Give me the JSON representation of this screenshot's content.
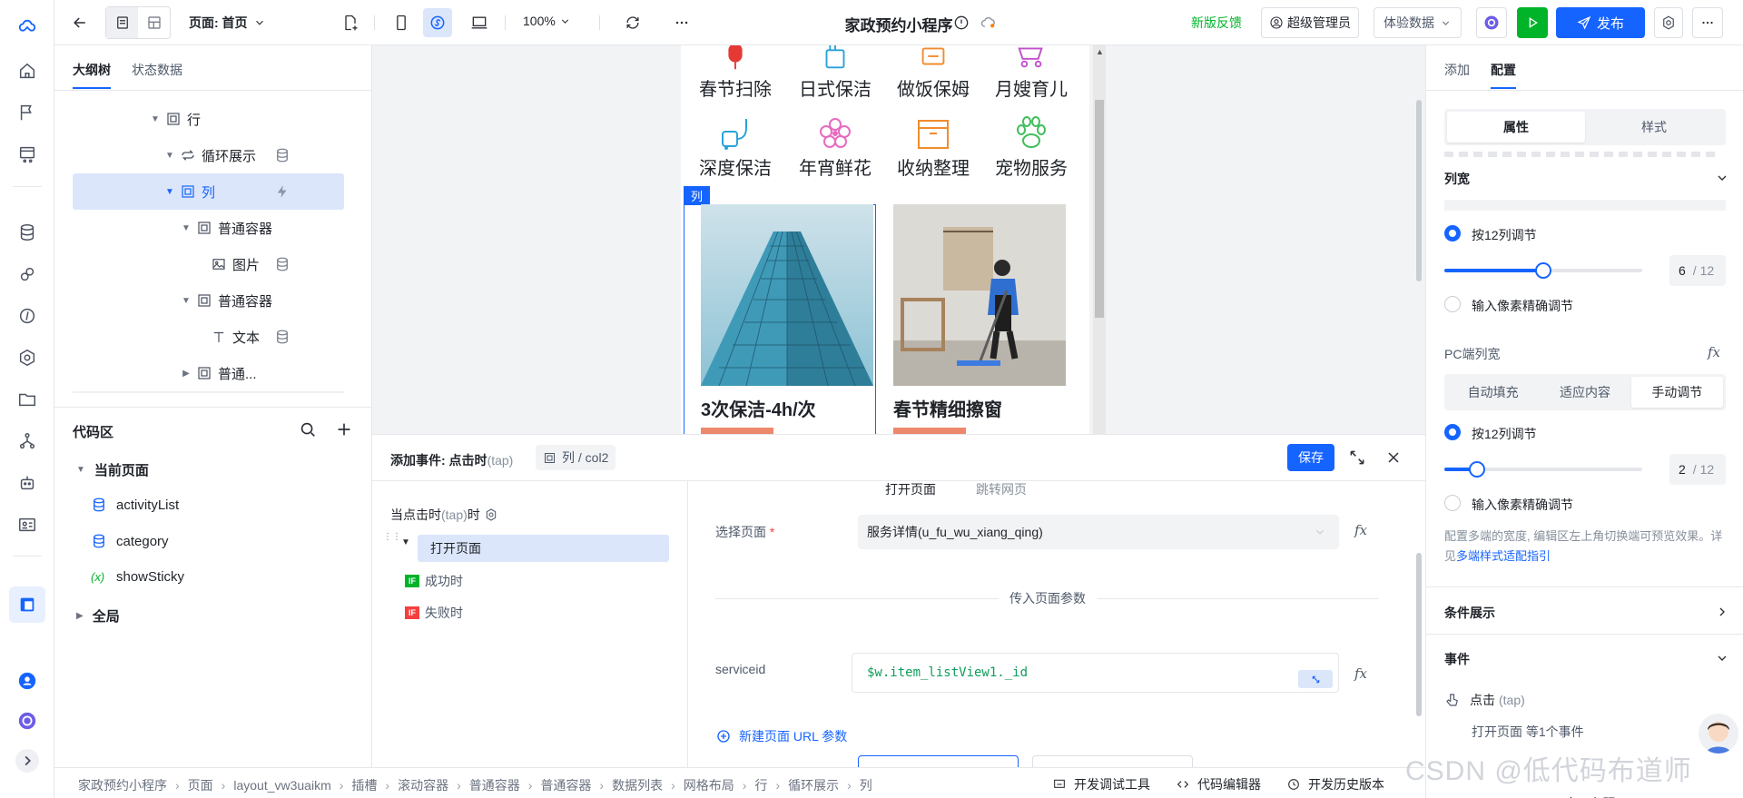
{
  "topbar": {
    "page_label": "页面: 首页",
    "zoom": "100%",
    "app_title": "家政预约小程序",
    "feedback": "新版反馈",
    "admin": "超级管理员",
    "data_mode": "体验数据",
    "publish": "发布"
  },
  "outline": {
    "tabs": [
      "大纲树",
      "状态数据"
    ],
    "items": [
      {
        "label": "行"
      },
      {
        "label": "循环展示"
      },
      {
        "label": "列"
      },
      {
        "label": "普通容器"
      },
      {
        "label": "图片"
      },
      {
        "label": "普通容器"
      },
      {
        "label": "文本"
      },
      {
        "label": "普通..."
      }
    ]
  },
  "code": {
    "title": "代码区",
    "current_page": "当前页面",
    "items": [
      "activityList",
      "category",
      "showSticky"
    ],
    "global": "全局"
  },
  "canvas": {
    "categories_row1": [
      "春节扫除",
      "日式保洁",
      "做饭保姆",
      "月嫂育儿"
    ],
    "categories_row2": [
      "深度保洁",
      "年宵鲜花",
      "收纳整理",
      "宠物服务"
    ],
    "col_badge": "列",
    "cards": [
      {
        "title": "3次保洁-4h/次"
      },
      {
        "title": "春节精细擦窗"
      }
    ],
    "colors": {
      "accent": "#1664ff",
      "selected": "#dbe6fb"
    }
  },
  "event_panel": {
    "title": "添加事件: 点击时",
    "title_tap": "(tap)",
    "target": "列 / col2",
    "save": "保存",
    "trigger": "当点击时",
    "trigger_tap": "(tap)",
    "trigger_suffix": "时",
    "action": "打开页面",
    "success": "成功时",
    "failure": "失败时",
    "tab_open": "打开页面",
    "tab_jump": "跳转网页",
    "select_page_label": "选择页面",
    "select_page_value": "服务详情(u_fu_wu_xiang_qing)",
    "params_divider": "传入页面参数",
    "param_name": "serviceid",
    "param_value": "$w.item_listView1._id",
    "add_url_param": "新建页面 URL 参数"
  },
  "right_panel": {
    "tabs": [
      "添加",
      "配置"
    ],
    "seg": [
      "属性",
      "样式"
    ],
    "col_width_title": "列宽",
    "by12": "按12列调节",
    "pixel": "输入像素精确调节",
    "mobile_value": "6",
    "unit": "/ 12",
    "pc_title": "PC端列宽",
    "pc_modes": [
      "自动填充",
      "适应内容",
      "手动调节"
    ],
    "pc_value": "2",
    "hint": "配置多端的宽度, 编辑区左上角切换端可预览效果。详见",
    "hint_link": "多端样式适配指引",
    "conditional": "条件展示",
    "events": "事件",
    "event_click": "点击",
    "event_click_tap": "(tap)",
    "event_summary": "打开页面 等1个事件",
    "mobile_progress": 0.5,
    "pc_progress": 0.1667
  },
  "breadcrumb": [
    "家政预约小程序",
    "页面",
    "layout_vw3uaikm",
    "插槽",
    "滚动容器",
    "普通容器",
    "普通容器",
    "数据列表",
    "网格布局",
    "行",
    "循环展示",
    "列"
  ],
  "bottom_tools": [
    "开发调试工具",
    "代码编辑器",
    "开发历史版本"
  ],
  "right_bottom": {
    "theme": "应用主题"
  },
  "watermark": "CSDN @低代码布道师"
}
